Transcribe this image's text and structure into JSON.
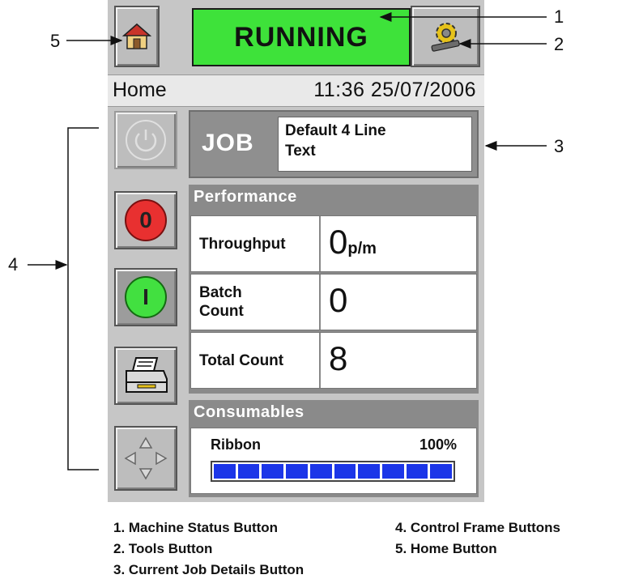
{
  "header": {
    "status_label": "RUNNING",
    "status_color": "#3ee23a"
  },
  "status_bar": {
    "page": "Home",
    "datetime": "11:36 25/07/2006"
  },
  "controls": [
    {
      "name": "power-button",
      "icon": "power-icon",
      "state": "disabled"
    },
    {
      "name": "stop-button",
      "label": "0",
      "color": "#e83030"
    },
    {
      "name": "start-button",
      "label": "I",
      "color": "#42e040"
    },
    {
      "name": "print-button",
      "icon": "printer-icon"
    },
    {
      "name": "navigate-button",
      "icon": "arrows-icon"
    }
  ],
  "job": {
    "tag": "JOB",
    "name_line1": "Default 4 Line",
    "name_line2": "Text"
  },
  "performance": {
    "title": "Performance",
    "rows": [
      {
        "label": "Throughput",
        "value": "0",
        "unit": "p/m"
      },
      {
        "label_line1": "Batch",
        "label_line2": "Count",
        "value": "0"
      },
      {
        "label": "Total Count",
        "value": "8"
      }
    ]
  },
  "consumables": {
    "title": "Consumables",
    "item": "Ribbon",
    "percent_text": "100%",
    "level": 1.0,
    "bar_color": "#1c36e8"
  },
  "callouts": {
    "n1": "1",
    "n2": "2",
    "n3": "3",
    "n4": "4",
    "n5": "5"
  },
  "legend": {
    "l1": "1. Machine Status Button",
    "l2": "2. Tools Button",
    "l3": "3. Current Job Details Button",
    "l4": "4. Control Frame Buttons",
    "l5": "5. Home Button"
  }
}
